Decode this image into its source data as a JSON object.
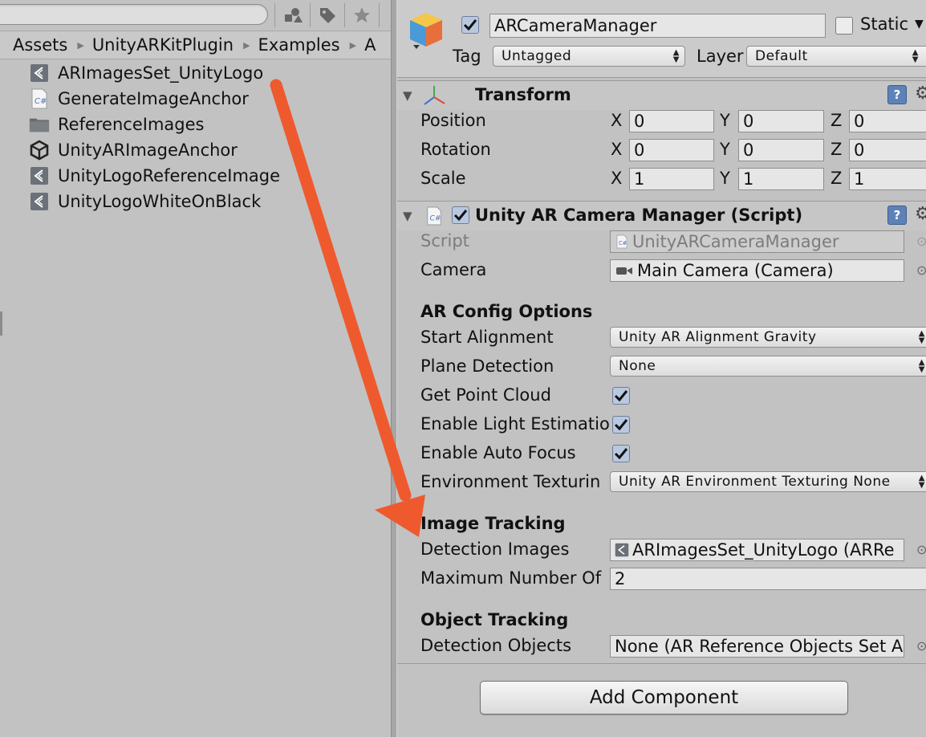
{
  "project": {
    "breadcrumb": [
      "Assets",
      "UnityARKitPlugin",
      "Examples",
      "A"
    ],
    "items": [
      {
        "label": "ARImagesSet_UnityLogo",
        "icon": "arref-icon"
      },
      {
        "label": "GenerateImageAnchor",
        "icon": "csharp-script-icon"
      },
      {
        "label": "ReferenceImages",
        "icon": "folder-icon"
      },
      {
        "label": "UnityARImageAnchor",
        "icon": "unity-logo-icon"
      },
      {
        "label": "UnityLogoReferenceImage",
        "icon": "arref-icon"
      },
      {
        "label": "UnityLogoWhiteOnBlack",
        "icon": "arref-icon"
      }
    ]
  },
  "inspector": {
    "object_name": "ARCameraManager",
    "static_label": "Static",
    "tag_label": "Tag",
    "tag_value": "Untagged",
    "layer_label": "Layer",
    "layer_value": "Default",
    "transform": {
      "title": "Transform",
      "rows": [
        {
          "label": "Position",
          "x": "0",
          "y": "0",
          "z": "0"
        },
        {
          "label": "Rotation",
          "x": "0",
          "y": "0",
          "z": "0"
        },
        {
          "label": "Scale",
          "x": "1",
          "y": "1",
          "z": "1"
        }
      ],
      "axis_x": "X",
      "axis_y": "Y",
      "axis_z": "Z"
    },
    "script_component": {
      "title": "Unity AR Camera Manager (Script)",
      "script_label": "Script",
      "script_value": "UnityARCameraManager",
      "camera_label": "Camera",
      "camera_value": "Main Camera (Camera)",
      "ar_config_heading": "AR Config Options",
      "start_alignment_label": "Start Alignment",
      "start_alignment_value": "Unity AR Alignment Gravity",
      "plane_detection_label": "Plane Detection",
      "plane_detection_value": "None",
      "point_cloud_label": "Get Point Cloud",
      "light_estimation_label": "Enable Light Estimatio",
      "auto_focus_label": "Enable Auto Focus",
      "env_texturing_label": "Environment Texturin",
      "env_texturing_value": "Unity AR Environment Texturing None",
      "image_tracking_heading": "Image Tracking",
      "detection_images_label": "Detection Images",
      "detection_images_value": "ARImagesSet_UnityLogo (ARRe",
      "max_number_label": "Maximum Number Of",
      "max_number_value": "2",
      "object_tracking_heading": "Object Tracking",
      "detection_objects_label": "Detection Objects",
      "detection_objects_value": "None (AR Reference Objects Set A"
    },
    "add_component_label": "Add Component"
  },
  "colors": {
    "arrow": "#ee5a2e",
    "panel_bg": "#c2c2c2",
    "help_blue": "#5d82b8"
  }
}
